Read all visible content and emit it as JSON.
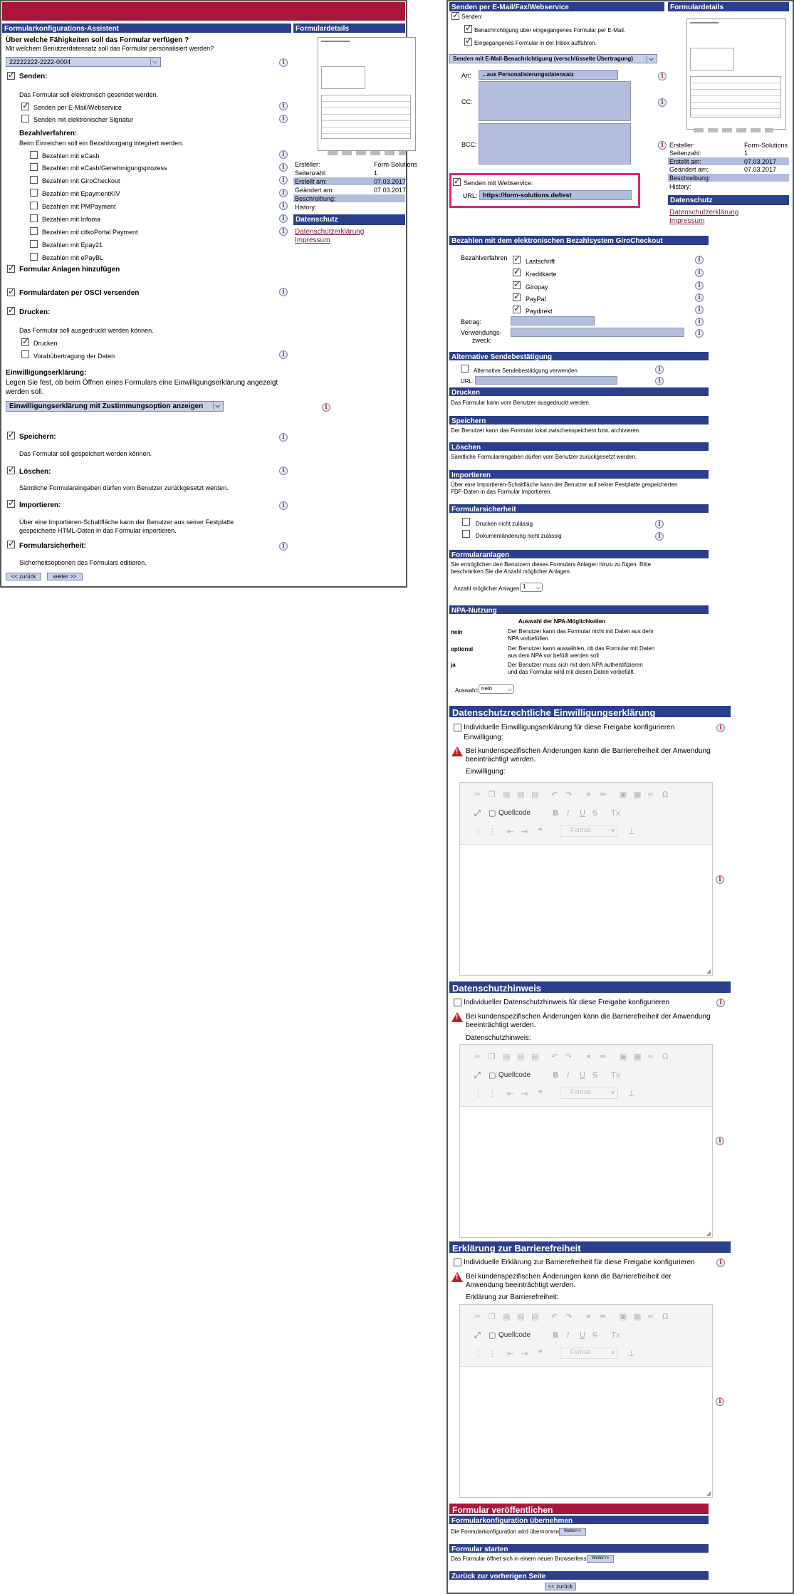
{
  "left": {
    "wizard_title": "Formularkonfigurations-Assistent",
    "details_title": "Formulardetails",
    "question": "Über welche Fähigkeiten soll das Formular verfügen ?",
    "subquestion": "Mit welchem Benutzerdatensatz soll das Formular personalisiert werden?",
    "dataset_value": "22222222-2222-0004",
    "senden_label": "Senden:",
    "senden_desc": "Das Formular soll elektronisch gesendet werden.",
    "send_email": "Senden per E-Mail/Webservice",
    "send_signatur": "Senden mit elektronischer Signatur",
    "bezahl_label": "Bezahlverfahren:",
    "bezahl_desc": "Beim Einreichen soll ein Bezahlvorgang integriert werden.",
    "pay": [
      "Bezahlen mit eCash",
      "Bezahlen mit eCash/Genehmigungsprozess",
      "Bezahlen mit GiroCheckout",
      "Bezahlen mit EpaymentKIV",
      "Bezahlen mit PMPayment",
      "Bezahlen mit Infoma",
      "Bezahlen mit citkoPortal Payment",
      "Bezahlen mit Epay21",
      "Bezahlen mit ePayBL"
    ],
    "anlagen": "Formular Anlagen hinzufügen",
    "osci": "Formulardaten per OSCI versenden",
    "drucken_label": "Drucken:",
    "drucken_desc": "Das Formular soll ausgedruckt werden können.",
    "drucken": "Drucken",
    "vorab": "Vorabübertragung der Daten",
    "einw_label": "Einwilligungserklärung:",
    "einw_desc1": "Legen Sie fest, ob beim Öffnen eines Formulars eine Einwilligungserklärung angezeigt",
    "einw_desc2": "werden soll.",
    "einw_select": "Einwilligungserklärung mit Zustimmungsoption anzeigen",
    "speichern_label": "Speichern:",
    "speichern_desc": "Das Formular soll gespeichert werden können.",
    "loeschen_label": "Löschen:",
    "loeschen_desc": "Sämtliche Formulareingaben dürfen vom Benutzer zurückgesetzt werden.",
    "import_label": "Importieren:",
    "import_desc1": "Über eine Importieren-Schaltfläche kann der Benutzer aus seiner Festplatte",
    "import_desc2": "gespeicherte HTML-Daten in das Formular importieren.",
    "sicher_label": "Formularsicherheit:",
    "sicher_desc": "Sicherheitsoptionen des Formulars editieren.",
    "back_btn": "<< zurück",
    "next_btn": "weiter >>",
    "meta": [
      {
        "k": "Ersteller:",
        "v": "Form-Solutions"
      },
      {
        "k": "Seitenzahl:",
        "v": "1"
      },
      {
        "k": "Erstellt am:",
        "v": "07.03.2017"
      },
      {
        "k": "Geändert am:",
        "v": "07.03.2017"
      },
      {
        "k": "Beschreibung:",
        "v": ""
      },
      {
        "k": "History:",
        "v": ""
      }
    ],
    "datenschutz_title": "Datenschutz",
    "link1": "Datenschutzerklärung",
    "link2": "Impressum"
  },
  "right": {
    "title": "Senden per E-Mail/Fax/Webservice",
    "details_title": "Formulardetails",
    "senden": "Senden:",
    "benach": "Benachrichtigung über eingegangenes Formular per E-Mail.",
    "inbox": "Eingegangenes Formular in der Inbox aufführen.",
    "mode_select": "Senden mit E-Mail-Benachrichtigung (verschlüsselte Übertragung)",
    "an_label": "An:",
    "an_value": "...aus Personalisierungsdatensatz",
    "cc_label": "CC:",
    "bcc_label": "BCC:",
    "ws_label": "Senden mit Webservice:",
    "url_label": "URL:",
    "url_value": "https://form-solutions.de/test",
    "meta": [
      {
        "k": "Ersteller:",
        "v": "Form-Solutions"
      },
      {
        "k": "Seitenzahl:",
        "v": "1"
      },
      {
        "k": "Erstellt am:",
        "v": "07.03.2017"
      },
      {
        "k": "Geändert am:",
        "v": "07.03.2017"
      },
      {
        "k": "Beschreibung:",
        "v": ""
      },
      {
        "k": "History:",
        "v": ""
      }
    ],
    "datenschutz_title": "Datenschutz",
    "link1": "Datenschutzerklärung",
    "link2": "Impressum",
    "giro_title": "Bezahlen mit dem elektronischen Bezahlsystem GiroCheckout",
    "bezahlverfahren": "Bezahlverfahren",
    "methods": [
      "Lastschrift",
      "Kreditkarte",
      "Giropay",
      "PayPal",
      "Paydirekt"
    ],
    "betrag": "Betrag:",
    "verw1": "Verwendungs-",
    "verw2": "zweck:",
    "alt_title": "Alternative Sendebestätigung",
    "alt_cb": "Alternative Sendebestätigung verwenden",
    "alt_url": "URL:",
    "drucken_title": "Drucken",
    "drucken_desc": "Das Formular kann vom Benutzer ausgedruckt werden.",
    "speichern_title": "Speichern",
    "speichern_desc": "Der Benutzer kann das Formular lokal zwischenspeichern bzw. archivieren.",
    "loeschen_title": "Löschen",
    "loeschen_desc": "Sämtliche Formulareingaben dürfen vom Benutzer zurückgesetzt werden.",
    "import_title": "Importieren",
    "import_desc1": "Über eine Importieren-Schaltfläche kann der Benutzer auf seiner Festplatte gespeicherten",
    "import_desc2": "FDF-Daten in das Formular importieren.",
    "sicher_title": "Formularsicherheit",
    "sicher1": "Drucken nicht zulässig",
    "sicher2": "Dokumentänderung nicht zulässig",
    "anlagen_title": "Formularanlagen",
    "anlagen_desc1": "Sie ermöglichen den Benutzern dieses Formulars Anlagen hinzu zu fügen. Bitte",
    "anlagen_desc2": "beschränken Sie die Anzahl möglicher Anlagen.",
    "anzahl_label": "Anzahl möglicher Anlagen:",
    "anzahl_value": "1",
    "npa_title": "NPA-Nutzung",
    "npa_head": "Auswahl der NPA-Möglichkeiten",
    "npa_rows": [
      {
        "k": "nein",
        "v1": "Der Benutzer kann das Formular nicht mit Daten aus dem",
        "v2": "NPA vorbefüllen"
      },
      {
        "k": "optional",
        "v1": "Der Benutzer kann auswählen, ob das Formular mit Daten",
        "v2": "aus dem NPA vor befüllt werden soll"
      },
      {
        "k": "ja",
        "v1": "Der Benutzer muss sich mit dem NPA authentifizieren",
        "v2": "und das Formular wird mit diesen Daten vorbefüllt."
      }
    ],
    "auswahl_label": "Auswahl:",
    "auswahl_value": "nein",
    "ds_einw_title": "Datenschutzrechtliche Einwilligungserklärung",
    "ds_einw_cb": "Individuelle Einwilligungserklärung für diese Freigabe konfigurieren",
    "ds_einw_sub": "Einwilligung:",
    "warn_text1": "Bei kundenspezifischen Änderungen kann die Barrierefreiheit der Anwendung",
    "warn_text2": "beeinträchtigt werden.",
    "editor1_label": "Einwilligung:",
    "ds_hinweis_title": "Datenschutzhinweis",
    "ds_hinweis_cb": "Individueller Datenschutzhinweis für diese Freigabe konfigurieren",
    "editor2_label": "Datenschutzhinweis:",
    "barr_title": "Erklärung zur Barrierefreiheit",
    "barr_cb": "Individuelle Erklärung zur Barrierefreiheit für diese Freigabe konfigurieren",
    "barr_warn1": "Bei kundenspezifischen Änderungen kann die Barrierefreiheit der",
    "barr_warn2": "Anwendung beeinträchtigt werden.",
    "editor3_label": "Erklärung zur Barrierefreiheit:",
    "quellcode": "Quellcode",
    "format": "Format",
    "publish_title": "Formular veröffentlichen",
    "uebern_title": "Formularkonfiguration übernehmen",
    "uebern_desc": "Die Formularkonfiguration wird übernommen.",
    "uebern_btn": "Weiter>>",
    "start_title": "Formular starten",
    "start_desc": "Das Formular öffnet sich in einem neuen Browserfenster.",
    "start_btn": "Weiter>>",
    "back_title": "Zurück zur vorherigen Seite",
    "back_btn": "<< zurück"
  },
  "colors": {
    "header": "#2b3f8a",
    "accent_red": "#a8173b",
    "field": "#b3bedf",
    "highlight": "#e0247c"
  },
  "icons": [
    "info-icon",
    "checkbox-icon",
    "warning-icon",
    "dropdown-arrow-icon"
  ]
}
